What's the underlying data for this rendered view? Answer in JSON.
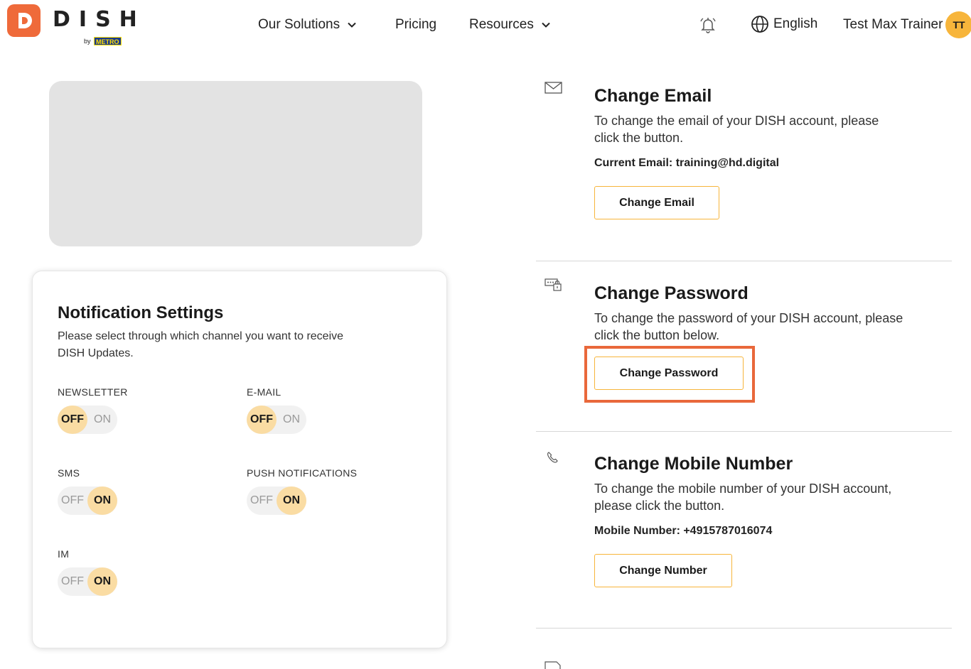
{
  "header": {
    "logo_letter": "D",
    "logo_text": "DISH",
    "logo_by": "by",
    "logo_metro": "METRO",
    "nav": {
      "solutions": "Our Solutions",
      "pricing": "Pricing",
      "resources": "Resources"
    },
    "language": "English",
    "user_name": "Test Max Trainer",
    "user_initials": "TT"
  },
  "notifications": {
    "title": "Notification Settings",
    "description": "Please select through which channel you want to receive DISH Updates.",
    "off_label": "OFF",
    "on_label": "ON",
    "channels": [
      {
        "label": "NEWSLETTER",
        "enabled": false
      },
      {
        "label": "E-MAIL",
        "enabled": false
      },
      {
        "label": "SMS",
        "enabled": true
      },
      {
        "label": "PUSH NOTIFICATIONS",
        "enabled": true
      },
      {
        "label": "IM",
        "enabled": true
      }
    ]
  },
  "account": {
    "email": {
      "title": "Change Email",
      "description": "To change the email of your DISH account, please click the button.",
      "meta": "Current Email: training@hd.digital",
      "button": "Change Email"
    },
    "password": {
      "title": "Change Password",
      "description": "To change the password of your DISH account, please click the button below.",
      "button": "Change Password"
    },
    "mobile": {
      "title": "Change Mobile Number",
      "description": "To change the mobile number of your DISH account, please click the button.",
      "meta": "Mobile Number: +4915787016074",
      "button": "Change Number"
    }
  },
  "colors": {
    "brand": "#ef6a3a",
    "accent": "#f7b53b",
    "toggle_knob": "#fadca3",
    "highlight": "#e9683b"
  },
  "icons": {
    "logo": "dish-logo-icon",
    "solutions_chevron": "chevron-down-icon",
    "resources_chevron": "chevron-down-icon",
    "notifications": "bell-icon",
    "language": "globe-icon",
    "email_section": "envelope-icon",
    "password_section": "password-icon",
    "mobile_section": "phone-icon",
    "next_section": "document-icon"
  }
}
